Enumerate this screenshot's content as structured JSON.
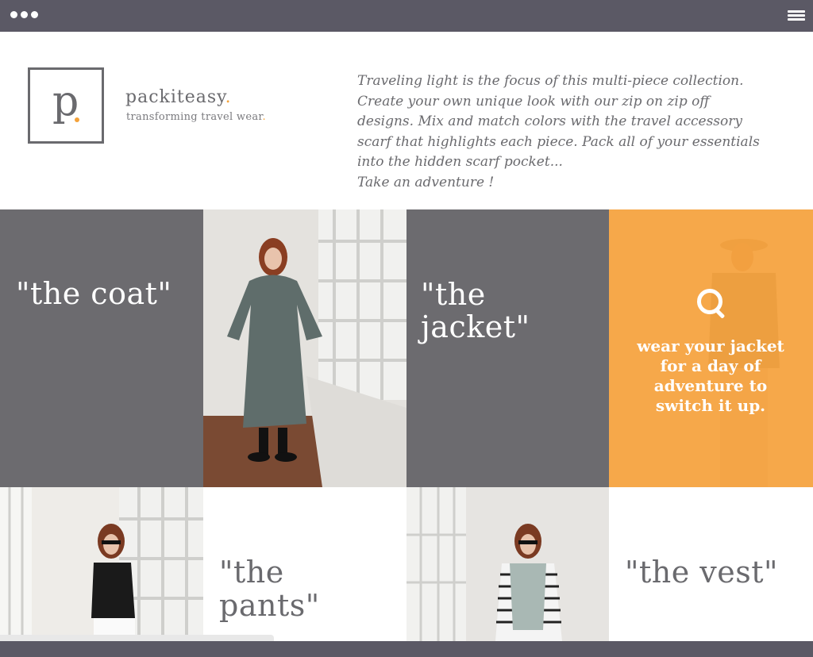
{
  "brand": {
    "logo_letter": "p",
    "name": "packiteasy",
    "name_accent": ".",
    "tagline": "transforming travel wear",
    "tagline_accent": "."
  },
  "intro": {
    "lines": [
      "Traveling light is the focus of this multi-piece collection.",
      "Create your own unique look with our zip on zip off",
      "designs. Mix and match colors with the travel accessory",
      "scarf that highlights each piece. Pack all of your essentials",
      "into the hidden scarf pocket...",
      "Take an adventure !"
    ]
  },
  "tiles": {
    "coat": {
      "title": "\"the coat\""
    },
    "jacket": {
      "title_line1": "\"the",
      "title_line2": "jacket\""
    },
    "jacket_overlay": {
      "text": "wear your jacket for a day of adventure to switch it up.",
      "icon": "search-icon"
    },
    "pants": {
      "title_line1": "\"the",
      "title_line2": "pants\""
    },
    "vest": {
      "title": "\"the vest\""
    }
  },
  "colors": {
    "chrome": "#5b5965",
    "tile_gray": "#6c6b6f",
    "accent_orange": "#f79f36",
    "text_gray": "#6a6a6e"
  }
}
